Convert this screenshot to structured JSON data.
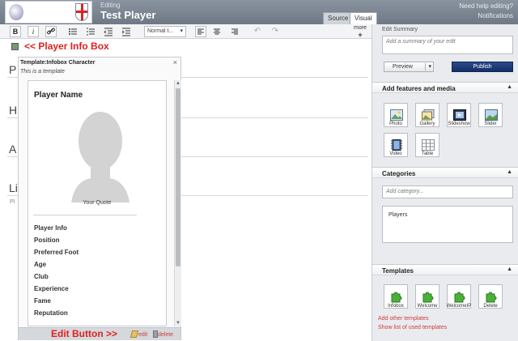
{
  "header": {
    "editing_label": "Editing",
    "page_title": "Test Player",
    "tabs": [
      "Source",
      "Visual"
    ],
    "help_link": "Need help editing?",
    "notifications_link": "Notifications",
    "logo_alt": "Football Star"
  },
  "toolbar": {
    "bold": "B",
    "italic": "i",
    "format_select": "Normal t...",
    "more_label": "more",
    "more_plus": "+"
  },
  "editor": {
    "annotation_player_info_box": "<< Player Info Box",
    "annotation_edit_button": "Edit Button >>",
    "hidden_headings": [
      "P",
      "H",
      "A",
      "Li"
    ],
    "pl_text": "Pl",
    "template": {
      "title": "Template:Infobox Character",
      "subtitle": "This is a template",
      "close": "×",
      "player_name": "Player Name",
      "quote": "Your Quote",
      "rows": [
        "Player Info",
        "Position",
        "Preferred Foot",
        "Age",
        "Club",
        "Experience",
        "Fame",
        "Reputation"
      ],
      "edit": "edit",
      "delete": "delete"
    }
  },
  "right": {
    "edit_summary_label": "Edit Summary",
    "summary_placeholder": "Add a summary of your edit",
    "preview": "Preview",
    "publish": "Publish",
    "features_header": "Add features and media",
    "media": [
      "Photo",
      "Gallery",
      "Slideshow",
      "Slider",
      "Video",
      "Table"
    ],
    "categories_header": "Categories",
    "category_placeholder": "Add category...",
    "categories": [
      "Players"
    ],
    "templates_header": "Templates",
    "templates": [
      "Infobox",
      "Welcome",
      "WelcomeIP",
      "Delete"
    ],
    "add_templates": "Add other templates",
    "show_templates": "Show list of used templates",
    "collapse_arrow": "▲"
  }
}
